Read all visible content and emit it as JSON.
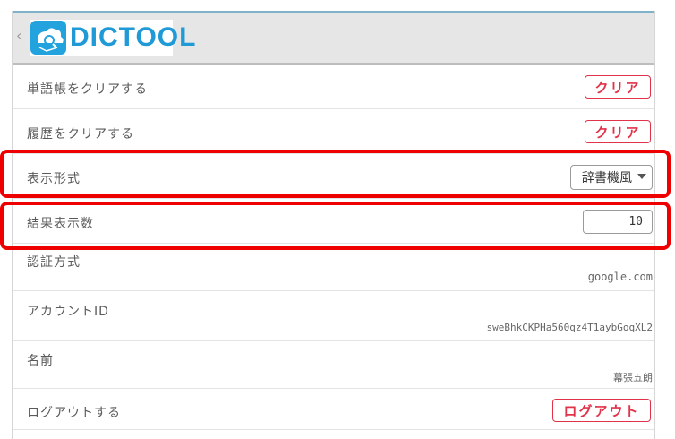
{
  "header": {
    "back_icon": "chevron-left-icon",
    "logo_text": "DICTOOL"
  },
  "settings": {
    "clear_wordbook_label": "単語帳をクリアする",
    "clear_wordbook_button": "クリア",
    "clear_history_label": "履歴をクリアする",
    "clear_history_button": "クリア",
    "display_format_label": "表示形式",
    "display_format_value": "辞書機風",
    "result_count_label": "結果表示数",
    "result_count_value": "10",
    "auth_method_label": "認証方式",
    "auth_method_value": "google.com",
    "account_id_label": "アカウントID",
    "account_id_value": "sweBhkCKPHa560qz4T1aybGoqXL2",
    "name_label": "名前",
    "name_value": "幕張五朗",
    "logout_label": "ログアウトする",
    "logout_button": "ログアウト"
  },
  "colors": {
    "accent_red": "#e0334a",
    "highlight_red": "#ee0000",
    "logo_blue": "#1f9ad6"
  }
}
